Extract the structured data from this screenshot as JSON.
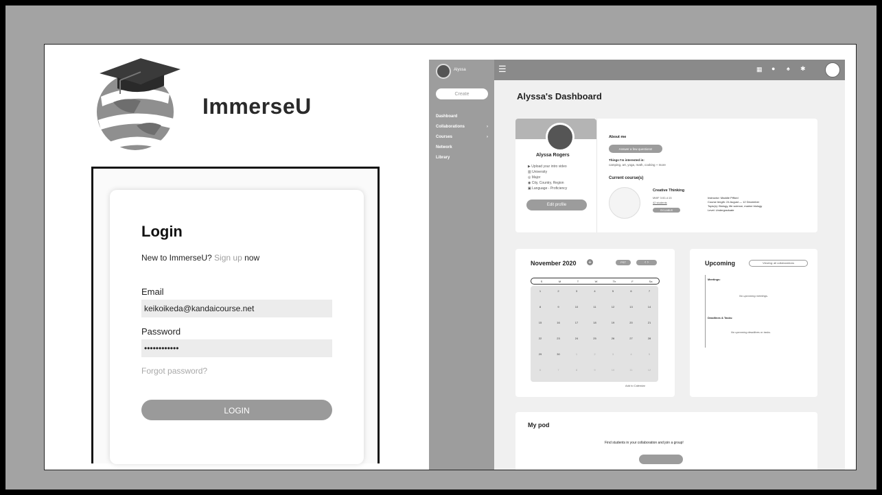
{
  "login": {
    "brand": "ImmerseU",
    "title": "Login",
    "sub_prefix": "New to ImmerseU?",
    "signup_link": "Sign up",
    "sub_suffix": "now",
    "email_label": "Email",
    "email_value": "keikoikeda@kandaicourse.net",
    "password_label": "Password",
    "password_value": "••••••••••••",
    "forgot": "Forgot password?",
    "button": "LOGIN"
  },
  "dashboard": {
    "user_short": "Alyssa",
    "create": "Create",
    "nav": [
      {
        "label": "Dashboard",
        "chev": ""
      },
      {
        "label": "Collaborations",
        "chev": "›"
      },
      {
        "label": "Courses",
        "chev": "›"
      },
      {
        "label": "Network",
        "chev": ""
      },
      {
        "label": "Library",
        "chev": ""
      }
    ],
    "title": "Alyssa's Dashboard",
    "profile": {
      "name": "Alyssa Rogers",
      "details": [
        "Upload your intro video",
        "University",
        "Major",
        "City, Country, Region",
        "Language - Proficiency"
      ],
      "edit": "Edit profile",
      "about_title": "About me",
      "answer_btn": "Answer a few questions!",
      "interests_title": "Things I'm interested in:",
      "interests": "camping, art, yoga, math, cooking + more",
      "courses_title": "Current course(s)",
      "course_name": "Creative Thinking",
      "course_time": "MWF 3:00-4:15",
      "course_students": "42 students",
      "syllabus": "SYLLABUS",
      "instructor": "Instructor: Maddie Pifford",
      "length": "Course length: 24 August — 12 December",
      "topics": "Topic(s): Biology, life science, marine biology",
      "level": "Level: Undergraduate"
    },
    "calendar": {
      "month": "November 2020",
      "tz": "PST",
      "days": [
        "S",
        "M",
        "T",
        "W",
        "Th",
        "F",
        "Sa"
      ],
      "rows": [
        [
          "",
          "1",
          "2",
          "3",
          "4",
          "5",
          "6",
          "7"
        ],
        [
          "8",
          "9",
          "10",
          "11",
          "12",
          "13",
          "14"
        ],
        [
          "15",
          "16",
          "17",
          "18",
          "19",
          "20",
          "21"
        ],
        [
          "22",
          "23",
          "24",
          "25",
          "26",
          "27",
          "28"
        ],
        [
          "29",
          "30",
          "1",
          "2",
          "3",
          "4",
          "5"
        ],
        [
          "6",
          "7",
          "8",
          "9",
          "10",
          "11",
          "12"
        ]
      ],
      "add": "Add to Calendar"
    },
    "upcoming": {
      "title": "Upcoming",
      "filter": "Viewing: all collaborations",
      "meetings_title": "Meetings:",
      "meetings_empty": "No upcoming meetings.",
      "deadlines_title": "Deadlines & Tasks:",
      "deadlines_empty": "No upcoming deadlines or tasks."
    },
    "pod": {
      "title": "My pod",
      "text": "Find students in your collaboration and join a group!"
    }
  }
}
